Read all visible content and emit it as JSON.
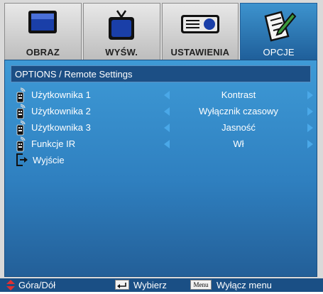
{
  "tabs": [
    {
      "label": "OBRAZ",
      "icon": "monitor-icon",
      "active": false
    },
    {
      "label": "WYŚW.",
      "icon": "tv-icon",
      "active": false
    },
    {
      "label": "USTAWIENIA",
      "icon": "projector-icon",
      "active": false
    },
    {
      "label": "OPCJE",
      "icon": "notepad-pencil-icon",
      "active": true
    }
  ],
  "header": {
    "title": "OPTIONS / Remote Settings"
  },
  "rows": [
    {
      "label": "Użytkownika 1",
      "value": "Kontrast",
      "icon": "remote-icon"
    },
    {
      "label": "Użytkownika 2",
      "value": "Wyłącznik czasowy",
      "icon": "remote-icon"
    },
    {
      "label": "Użytkownika 3",
      "value": "Jasność",
      "icon": "remote-icon"
    },
    {
      "label": "Funkcje IR",
      "value": "Wł",
      "icon": "remote-icon"
    },
    {
      "label": "Wyjście",
      "icon": "exit-icon"
    }
  ],
  "footer": {
    "nav_label": "Góra/Dół",
    "select_label": "Wybierz",
    "menu_key": "Menu",
    "menu_label": "Wyłącz menu"
  },
  "colors": {
    "accent": "#2f80c0",
    "arrow": "#4aa8e8",
    "header": "#1c4f85",
    "footer": "#1a4f85"
  }
}
